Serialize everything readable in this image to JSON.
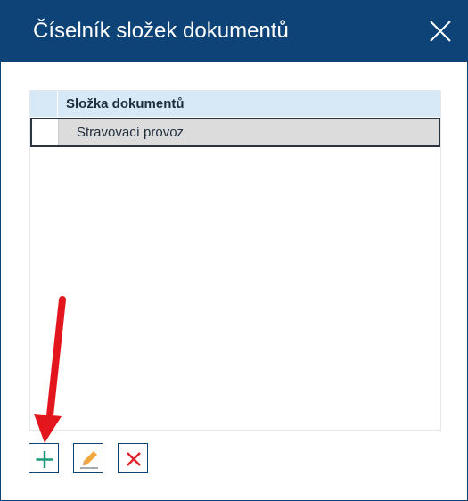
{
  "dialog": {
    "title": "Číselník složek dokumentů"
  },
  "grid": {
    "columns": [
      "Složka dokumentů"
    ],
    "rows": [
      {
        "slozka": "Stravovací provoz",
        "selected": true
      }
    ]
  },
  "toolbar": {
    "buttons": [
      "plus-icon",
      "pencil-icon",
      "delete-x-icon"
    ]
  },
  "colors": {
    "titlebar": "#0d4377",
    "header_bg": "#d7e9f7",
    "selected_row_bg": "#dcdcdc",
    "add_icon": "#1a9a7a",
    "delete_icon": "#e0242c",
    "annotation_arrow": "#e3161d"
  }
}
